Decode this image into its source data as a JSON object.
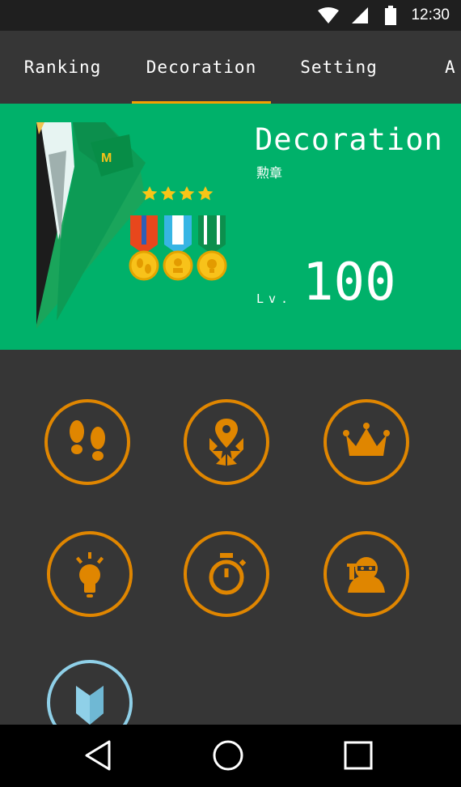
{
  "status_bar": {
    "time": "12:30"
  },
  "tabs": [
    {
      "label": "Ranking",
      "selected": false
    },
    {
      "label": "Decoration",
      "selected": true
    },
    {
      "label": "Setting",
      "selected": false
    },
    {
      "label": "A",
      "selected": false
    }
  ],
  "hero": {
    "title": "Decoration",
    "subtitle": "勲章",
    "level_label": "Lv.",
    "level_value": "100",
    "emblem_letter": "M",
    "stars": 4
  },
  "badges": [
    {
      "icon": "footprints-icon",
      "state": "earned"
    },
    {
      "icon": "map-pin-arrows-icon",
      "state": "earned"
    },
    {
      "icon": "crown-icon",
      "state": "earned"
    },
    {
      "icon": "lightbulb-icon",
      "state": "earned"
    },
    {
      "icon": "stopwatch-icon",
      "state": "earned"
    },
    {
      "icon": "ninja-icon",
      "state": "earned"
    },
    {
      "icon": "beginner-mark-icon",
      "state": "earned"
    }
  ],
  "colors": {
    "accent": "#f5a000",
    "badge_orange": "#e08600",
    "hero_green": "#00b16a",
    "background": "#363636",
    "beginner_blue": "#8fd0e8"
  }
}
